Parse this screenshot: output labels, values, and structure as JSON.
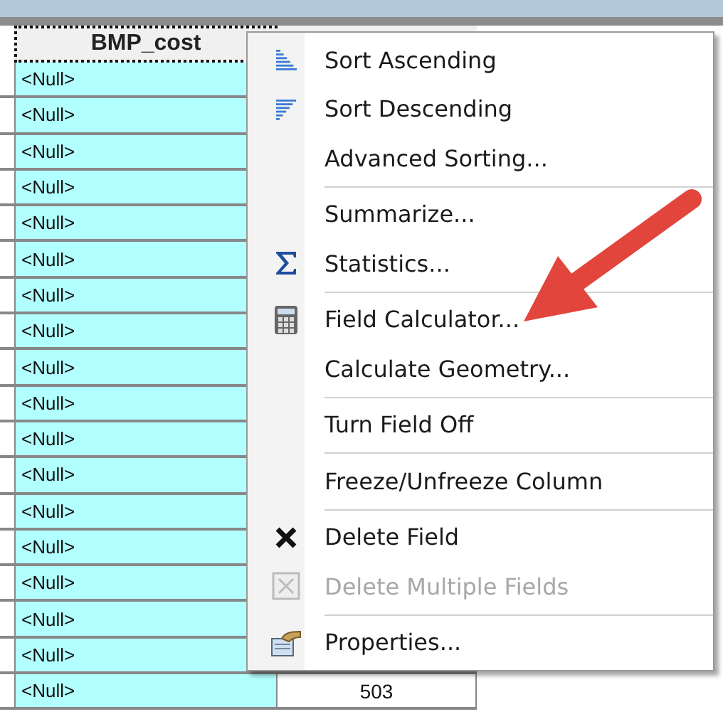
{
  "table": {
    "columns": [
      "BMP_cost"
    ],
    "rows": [
      {
        "bmp_cost": "<Null>"
      },
      {
        "bmp_cost": "<Null>"
      },
      {
        "bmp_cost": "<Null>"
      },
      {
        "bmp_cost": "<Null>"
      },
      {
        "bmp_cost": "<Null>"
      },
      {
        "bmp_cost": "<Null>"
      },
      {
        "bmp_cost": "<Null>"
      },
      {
        "bmp_cost": "<Null>"
      },
      {
        "bmp_cost": "<Null>"
      },
      {
        "bmp_cost": "<Null>"
      },
      {
        "bmp_cost": "<Null>"
      },
      {
        "bmp_cost": "<Null>"
      },
      {
        "bmp_cost": "<Null>"
      },
      {
        "bmp_cost": "<Null>"
      },
      {
        "bmp_cost": "<Null>"
      },
      {
        "bmp_cost": "<Null>"
      },
      {
        "bmp_cost": "<Null>"
      },
      {
        "bmp_cost": "<Null>",
        "column_2": "503"
      }
    ]
  },
  "context_menu": {
    "items": [
      {
        "kind": "item",
        "label": "Sort Ascending",
        "disabled": false
      },
      {
        "kind": "item",
        "label": "Sort Descending",
        "disabled": false
      },
      {
        "kind": "item",
        "label": "Advanced Sorting...",
        "disabled": false
      },
      {
        "kind": "separator"
      },
      {
        "kind": "item",
        "label": "Summarize...",
        "disabled": false
      },
      {
        "kind": "item",
        "label": "Statistics...",
        "disabled": false
      },
      {
        "kind": "separator"
      },
      {
        "kind": "item",
        "label": "Field Calculator...",
        "disabled": false
      },
      {
        "kind": "item",
        "label": "Calculate Geometry...",
        "disabled": false
      },
      {
        "kind": "separator"
      },
      {
        "kind": "item",
        "label": "Turn Field Off",
        "disabled": false
      },
      {
        "kind": "separator"
      },
      {
        "kind": "item",
        "label": "Freeze/Unfreeze Column",
        "disabled": false
      },
      {
        "kind": "separator"
      },
      {
        "kind": "item",
        "label": "Delete Field",
        "disabled": false
      },
      {
        "kind": "item",
        "label": "Delete Multiple Fields",
        "disabled": true
      },
      {
        "kind": "separator"
      },
      {
        "kind": "item",
        "label": "Properties...",
        "disabled": false
      }
    ]
  }
}
